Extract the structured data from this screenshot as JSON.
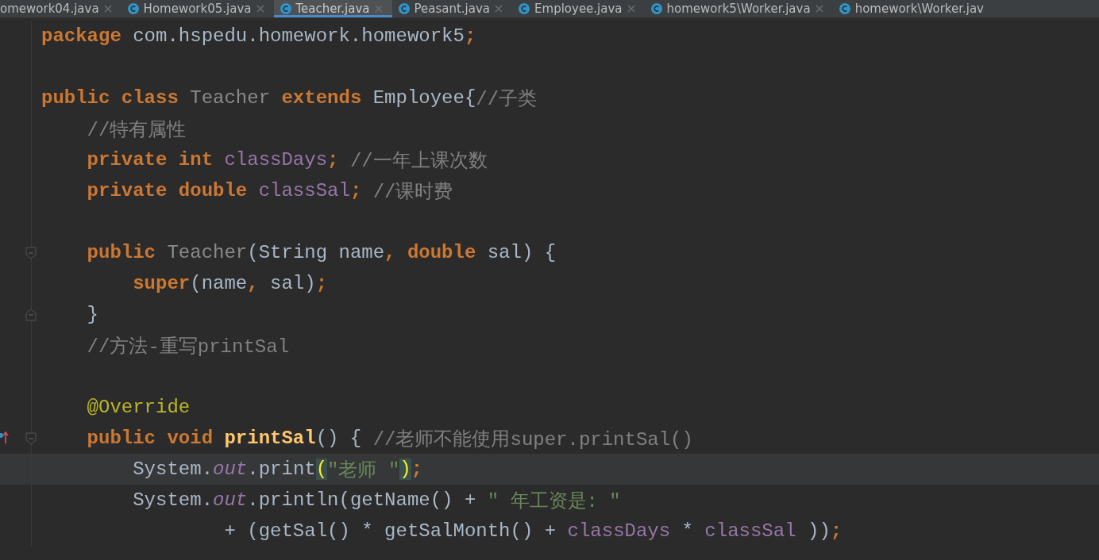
{
  "tabs": [
    {
      "label": "omework04.java",
      "icon": false,
      "closable": true,
      "selected": false
    },
    {
      "label": "Homework05.java",
      "icon": true,
      "closable": true,
      "selected": false
    },
    {
      "label": "Teacher.java",
      "icon": true,
      "closable": true,
      "selected": true
    },
    {
      "label": "Peasant.java",
      "icon": true,
      "closable": true,
      "selected": false
    },
    {
      "label": "Employee.java",
      "icon": true,
      "closable": true,
      "selected": false
    },
    {
      "label": "homework5\\Worker.java",
      "icon": true,
      "closable": true,
      "selected": false
    },
    {
      "label": "homework\\Worker.jav",
      "icon": true,
      "closable": false,
      "selected": false
    }
  ],
  "lines": [
    {
      "current": false,
      "tokens": [
        {
          "kind": "keyword",
          "text": "package "
        },
        {
          "kind": "plain",
          "text": "com.hspedu.homework.homework5"
        },
        {
          "kind": "keyword",
          "text": ";"
        }
      ]
    },
    {
      "current": false
    },
    {
      "current": false,
      "tokens": [
        {
          "kind": "keyword",
          "text": "public class "
        },
        {
          "kind": "unused",
          "text": "Teacher"
        },
        {
          "kind": "keyword",
          "text": " extends "
        },
        {
          "kind": "plain",
          "text": "Employee{"
        },
        {
          "kind": "comment",
          "text": "//子类"
        }
      ]
    },
    {
      "current": false,
      "tokens": [
        {
          "kind": "comment",
          "text": "    //特有属性"
        }
      ]
    },
    {
      "current": false,
      "tokens": [
        {
          "kind": "keyword",
          "text": "    private int "
        },
        {
          "kind": "field",
          "text": "classDays"
        },
        {
          "kind": "keyword",
          "text": "; "
        },
        {
          "kind": "comment",
          "text": "//一年上课次数"
        }
      ]
    },
    {
      "current": false,
      "tokens": [
        {
          "kind": "keyword",
          "text": "    private double "
        },
        {
          "kind": "field",
          "text": "classSal"
        },
        {
          "kind": "keyword",
          "text": "; "
        },
        {
          "kind": "comment",
          "text": "//课时费"
        }
      ]
    },
    {
      "current": false
    },
    {
      "current": false,
      "markers": [
        {
          "kind": "fold-start"
        }
      ],
      "tokens": [
        {
          "kind": "keyword",
          "text": "    public "
        },
        {
          "kind": "unused",
          "text": "Teacher"
        },
        {
          "kind": "plain",
          "text": "(String name"
        },
        {
          "kind": "keyword",
          "text": ", double "
        },
        {
          "kind": "plain",
          "text": "sal) {"
        }
      ]
    },
    {
      "current": false,
      "tokens": [
        {
          "kind": "keyword",
          "text": "        super"
        },
        {
          "kind": "plain",
          "text": "(name"
        },
        {
          "kind": "keyword",
          "text": ", "
        },
        {
          "kind": "plain",
          "text": "sal)"
        },
        {
          "kind": "keyword",
          "text": ";"
        }
      ]
    },
    {
      "current": false,
      "markers": [
        {
          "kind": "fold-end"
        }
      ],
      "tokens": [
        {
          "kind": "plain",
          "text": "    }"
        }
      ]
    },
    {
      "current": false,
      "tokens": [
        {
          "kind": "comment",
          "text": "    //方法-重写printSal"
        }
      ]
    },
    {
      "current": false
    },
    {
      "current": false,
      "tokens": [
        {
          "kind": "annotation",
          "text": "    @Override"
        }
      ]
    },
    {
      "current": false,
      "markers": [
        {
          "kind": "override"
        },
        {
          "kind": "fold-start"
        }
      ],
      "tokens": [
        {
          "kind": "keyword",
          "text": "    public void "
        },
        {
          "kind": "method",
          "text": "printSal"
        },
        {
          "kind": "plain",
          "text": "() { "
        },
        {
          "kind": "comment",
          "text": "//老师不能使用super.printSal()"
        }
      ]
    },
    {
      "current": true,
      "tokens": [
        {
          "kind": "plain",
          "text": "        System."
        },
        {
          "kind": "static",
          "text": "out"
        },
        {
          "kind": "plain",
          "text": ".print"
        },
        {
          "kind": "brace",
          "text": "("
        },
        {
          "kind": "string",
          "text": "\"老师 \""
        },
        {
          "kind": "brace",
          "text": ")"
        },
        {
          "kind": "keyword",
          "text": ";"
        }
      ]
    },
    {
      "current": false,
      "tokens": [
        {
          "kind": "plain",
          "text": "        System."
        },
        {
          "kind": "static",
          "text": "out"
        },
        {
          "kind": "plain",
          "text": ".println(getName() + "
        },
        {
          "kind": "string",
          "text": "\" 年工资是: \""
        }
      ]
    },
    {
      "current": false,
      "tokens": [
        {
          "kind": "plain",
          "text": "                + (getSal() * getSalMonth() + "
        },
        {
          "kind": "field",
          "text": "classDays"
        },
        {
          "kind": "plain",
          "text": " * "
        },
        {
          "kind": "field",
          "text": "classSal"
        },
        {
          "kind": "plain",
          "text": " ))"
        },
        {
          "kind": "keyword",
          "text": ";"
        }
      ]
    }
  ]
}
